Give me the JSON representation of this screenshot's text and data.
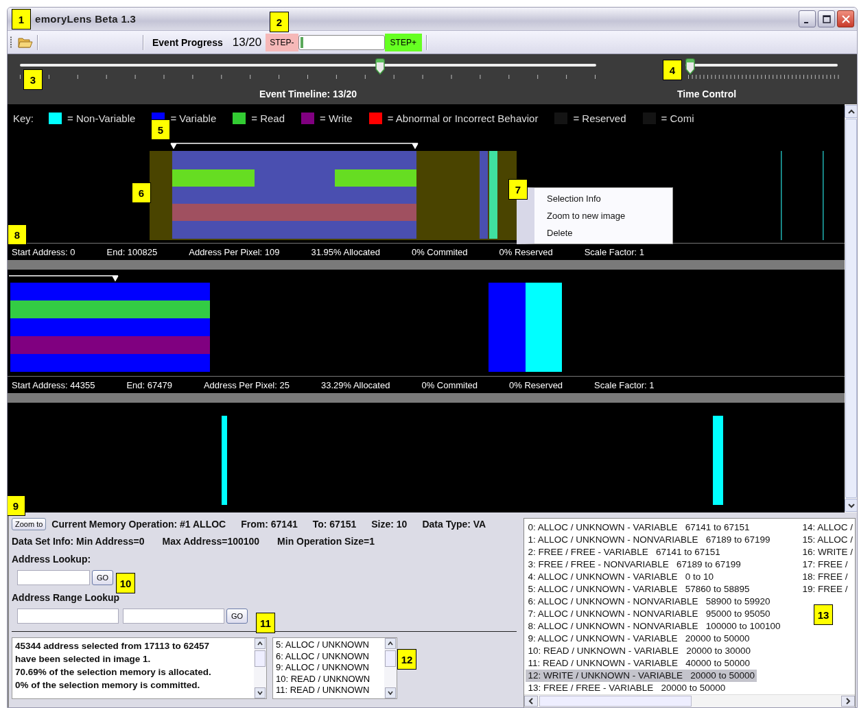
{
  "window": {
    "title": "emoryLens Beta 1.3"
  },
  "toolbar": {
    "label": "Event Progress",
    "count": "13/20",
    "step_back": "STEP-",
    "progress": {
      "level": 0.04
    },
    "step_forward": "STEP+"
  },
  "timeline": {
    "label": "Event Timeline: 13/20",
    "level": 0.625
  },
  "time_control": {
    "label": "Time Control",
    "level": 0
  },
  "key": {
    "label": "Key:",
    "items": [
      {
        "text": "= Non-Variable",
        "color": "#00ffff"
      },
      {
        "text": "= Variable",
        "color": "#0000ff"
      },
      {
        "text": "= Read",
        "color": "#33cc33"
      },
      {
        "text": "= Write",
        "color": "#800080"
      },
      {
        "text": "= Abnormal or Incorrect Behavior",
        "color": "#ff0000"
      },
      {
        "text": "= Reserved",
        "color": "#141414"
      },
      {
        "text": "= Comi",
        "color": "#141414"
      }
    ]
  },
  "memory_images": [
    {
      "stats": [
        "Start Address: 0",
        "End: 100825",
        "Address Per Pixel: 109",
        "31.95% Allocated",
        "0% Commited",
        "0% Reserved",
        "Scale Factor: 1"
      ]
    },
    {
      "stats": [
        "Start Address: 44355",
        "End: 67479",
        "Address Per Pixel: 25",
        "33.29% Allocated",
        "0% Commited",
        "0% Reserved",
        "Scale Factor: 1"
      ]
    }
  ],
  "context_menu": {
    "items": [
      "Selection Info",
      "Zoom to new image",
      "Delete"
    ]
  },
  "operation": {
    "button": "Zoom to",
    "fields": [
      "Current Memory Operation: #1  ALLOC",
      "From: 67141",
      "To: 67151",
      "Size: 10",
      "Data Type: VA"
    ]
  },
  "dataset_info": [
    "Data Set Info: Min Address=0",
    "Max Address=100100",
    "Min Operation Size=1"
  ],
  "address_lookup": {
    "label": "Address Lookup:",
    "button": "GO"
  },
  "range_lookup": {
    "label": "Address Range Lookup",
    "button": "GO"
  },
  "selection_info": [
    "45344 address selected from 17113 to 62457",
    "have been selected in image 1.",
    "70.69%  of the selection memory is allocated.",
    "0%  of the selection memory is committed."
  ],
  "selection_list": [
    "5: ALLOC / UNKNOWN",
    "6: ALLOC / UNKNOWN",
    "9: ALLOC / UNKNOWN",
    "10: READ / UNKNOWN",
    "11: READ / UNKNOWN"
  ],
  "event_list": {
    "columns": [
      [
        {
          "text": "0: ALLOC / UNKNOWN - VARIABLE   67141 to 67151",
          "selected": false
        },
        {
          "text": "1: ALLOC / UNKNOWN - NONVARIABLE   67189 to 67199",
          "selected": false
        },
        {
          "text": "2: FREE / FREE - VARIABLE   67141 to 67151",
          "selected": false
        },
        {
          "text": "3: FREE / FREE - NONVARIABLE   67189 to 67199",
          "selected": false
        },
        {
          "text": "4: ALLOC / UNKNOWN - VARIABLE   0 to 10",
          "selected": false
        },
        {
          "text": "5: ALLOC / UNKNOWN - VARIABLE   57860 to 58895",
          "selected": false
        },
        {
          "text": "6: ALLOC / UNKNOWN - NONVARIABLE   58900 to 59920",
          "selected": false
        },
        {
          "text": "7: ALLOC / UNKNOWN - NONVARIABLE   95000 to 95050",
          "selected": false
        },
        {
          "text": "8: ALLOC / UNKNOWN - NONVARIABLE   100000 to 100100",
          "selected": false
        },
        {
          "text": "9: ALLOC / UNKNOWN - VARIABLE   20000 to 50000",
          "selected": false
        },
        {
          "text": "10: READ / UNKNOWN - VARIABLE   20000 to 30000",
          "selected": false
        },
        {
          "text": "11: READ / UNKNOWN - VARIABLE   40000 to 50000",
          "selected": false
        },
        {
          "text": "12: WRITE / UNKNOWN - VARIABLE   20000 to 50000",
          "selected": true
        },
        {
          "text": "13: FREE / FREE - VARIABLE   20000 to 50000",
          "selected": false
        }
      ],
      [
        {
          "text": "14: ALLOC /",
          "selected": false
        },
        {
          "text": "15: ALLOC /",
          "selected": false
        },
        {
          "text": "16: WRITE /",
          "selected": false
        },
        {
          "text": "17: FREE /",
          "selected": false
        },
        {
          "text": "18: FREE /",
          "selected": false
        },
        {
          "text": "19: FREE /",
          "selected": false
        }
      ]
    ]
  },
  "callouts": [
    "1",
    "2",
    "3",
    "4",
    "5",
    "6",
    "7",
    "8",
    "9",
    "10",
    "11",
    "12",
    "13"
  ]
}
